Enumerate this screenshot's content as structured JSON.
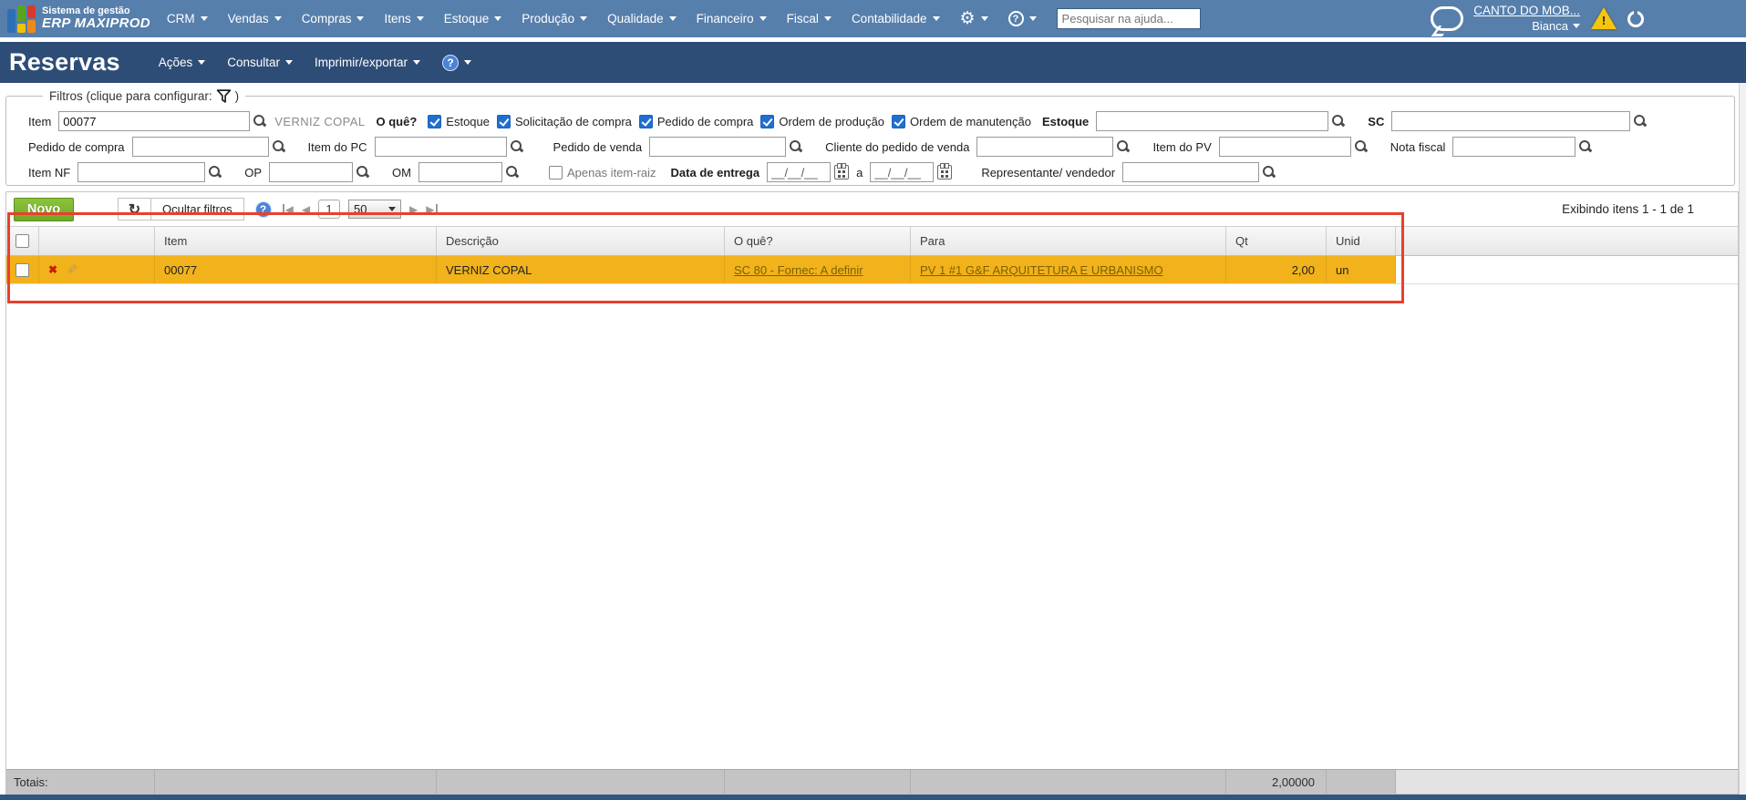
{
  "topbar": {
    "logo_tagline": "Sistema de gestão",
    "logo_name": "ERP MAXIPROD",
    "menus": [
      "CRM",
      "Vendas",
      "Compras",
      "Itens",
      "Estoque",
      "Produção",
      "Qualidade",
      "Financeiro",
      "Fiscal",
      "Contabilidade"
    ],
    "search_placeholder": "Pesquisar na ajuda...",
    "account_link": "CANTO DO MOB...",
    "user_name": "Bianca"
  },
  "titlebar": {
    "title": "Reservas",
    "menus": [
      "Ações",
      "Consultar",
      "Imprimir/exportar"
    ]
  },
  "filters": {
    "legend_prefix": "Filtros (clique para configurar:",
    "legend_suffix": ")",
    "row1": {
      "item_label": "Item",
      "item_value": "00077",
      "item_hint": "VERNIZ COPAL",
      "oque_label": "O quê?",
      "checkboxes": [
        "Estoque",
        "Solicitação de compra",
        "Pedido de compra",
        "Ordem de produção",
        "Ordem de manutenção"
      ],
      "estoque_label": "Estoque",
      "sc_label": "SC"
    },
    "row2_labels": [
      "Pedido de compra",
      "Item do PC",
      "Pedido de venda",
      "Cliente do pedido de venda",
      "Item do PV",
      "Nota fiscal"
    ],
    "row3": {
      "item_nf_label": "Item NF",
      "op_label": "OP",
      "om_label": "OM",
      "apenas_item_raiz_label": "Apenas item-raiz",
      "data_entrega_label": "Data de entrega",
      "date_placeholder": "__/__/__",
      "a_label": "a",
      "representante_label": "Representante/ vendedor"
    }
  },
  "toolbar": {
    "novo_label": "Novo",
    "ocultar_label": "Ocultar filtros",
    "page": "1",
    "page_size": "50",
    "status": "Exibindo itens 1 - 1 de 1"
  },
  "table": {
    "headers": [
      "Item",
      "Descrição",
      "O quê?",
      "Para",
      "Qt",
      "Unid"
    ],
    "row": {
      "item": "00077",
      "descricao": "VERNIZ COPAL",
      "oque": "SC 80 - Fornec: A definir",
      "para": "PV 1 #1 G&F ARQUITETURA E URBANISMO",
      "qt": "2,00",
      "unid": "un"
    },
    "totals_label": "Totais:",
    "totals_qt": "2,00000"
  },
  "icons": {
    "gear": "⚙",
    "help": "?",
    "refresh": "↻",
    "warning": "!",
    "delete": "✖",
    "edit": "✎",
    "prev": "◀",
    "next": "▶"
  },
  "colors": {
    "topbar_blue": "#567fac",
    "titlebar_navy": "#2e4d76",
    "row_highlight_orange": "#f2b21b",
    "annotation_red": "#e8402d",
    "novo_green": "#7db32f",
    "checkbox_blue": "#1f6fd0",
    "row_link_brown": "#7d6100"
  }
}
